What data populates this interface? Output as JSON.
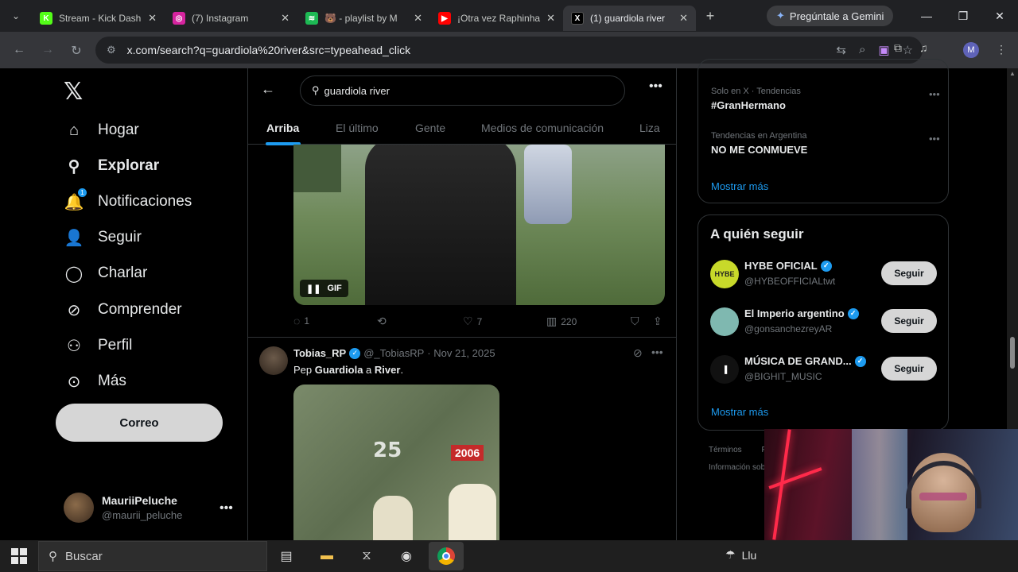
{
  "browser": {
    "tabs": [
      {
        "title": "Stream - Kick Dash",
        "icon": "kick-icon",
        "color": "#53fc18",
        "glyph": "K"
      },
      {
        "title": "(7) Instagram",
        "icon": "instagram-icon",
        "color": "#d6249f",
        "glyph": "◎"
      },
      {
        "title": "🐻 - playlist by M",
        "icon": "spotify-icon",
        "color": "#1db954",
        "glyph": "≋"
      },
      {
        "title": "¡Otra vez Raphinha",
        "icon": "youtube-icon",
        "color": "#ff0000",
        "glyph": "▶"
      },
      {
        "title": "(1) guardiola river",
        "icon": "x-icon",
        "color": "#000000",
        "glyph": "X"
      }
    ],
    "gemini_label": "Pregúntale a Gemini",
    "url": "x.com/search?q=guardiola%20river&src=typeahead_click",
    "profile_initial": "M"
  },
  "x": {
    "nav": [
      {
        "label": "Hogar",
        "icon": "home-icon",
        "glyph": "⌂",
        "bold": false
      },
      {
        "label": "Explorar",
        "icon": "search-icon",
        "glyph": "⚲",
        "bold": true
      },
      {
        "label": "Notificaciones",
        "icon": "bell-icon",
        "glyph": "🔔",
        "bold": false,
        "badge": "1"
      },
      {
        "label": "Seguir",
        "icon": "add-person-icon",
        "glyph": "👤",
        "bold": false
      },
      {
        "label": "Charlar",
        "icon": "chat-icon",
        "glyph": "◯",
        "bold": false
      },
      {
        "label": "Comprender",
        "icon": "grok-icon",
        "glyph": "⊘",
        "bold": false
      },
      {
        "label": "Perfil",
        "icon": "profile-icon",
        "glyph": "⚇",
        "bold": false
      },
      {
        "label": "Más",
        "icon": "more-circle-icon",
        "glyph": "⊙",
        "bold": false
      }
    ],
    "post_button": "Correo",
    "user": {
      "name": "MauriiPeluche",
      "handle": "@maurii_peluche"
    },
    "search_value": "guardiola river",
    "search_tabs": [
      "Arriba",
      "El último",
      "Gente",
      "Medios de comunicación",
      "Liza"
    ],
    "tweet1": {
      "gif_label": "GIF",
      "replies": "1",
      "likes": "7",
      "views": "220"
    },
    "tweet2": {
      "name": "Tobias_RP",
      "handle": "@_TobiasRP",
      "date": "· Nov 21, 2025",
      "text_prefix": "Pep ",
      "text_bold1": "Guardiola",
      "text_mid": " a ",
      "text_bold2": "River",
      "text_suffix": ".",
      "video_logo": "25",
      "video_year": "2006"
    },
    "trends": [
      {
        "meta": "Solo en X · Tendencias",
        "title": "#GranHermano"
      },
      {
        "meta": "Tendencias en Argentina",
        "title": "NO ME CONMUEVE"
      }
    ],
    "show_more": "Mostrar más",
    "who_to_follow_title": "A quién seguir",
    "follow": [
      {
        "name": "HYBE OFICIAL",
        "handle": "@HYBEOFFICIALtwt",
        "btn": "Seguir",
        "avatar_text": "HYBE",
        "avatar_bg": "#c8d92a"
      },
      {
        "name": "El Imperio argentino",
        "handle": "@gonsanchezreyAR",
        "btn": "Seguir",
        "avatar_text": "",
        "avatar_bg": "#7fb8b0"
      },
      {
        "name": "MÚSICA DE GRAND...",
        "handle": "@BIGHIT_MUSIC",
        "btn": "Seguir",
        "avatar_text": "▐",
        "avatar_bg": "#111111"
      }
    ],
    "footer_1": "Términos",
    "footer_1b": "Pr",
    "footer_2": "Información sob"
  },
  "taskbar": {
    "search_placeholder": "Buscar",
    "weather": "Llu"
  }
}
